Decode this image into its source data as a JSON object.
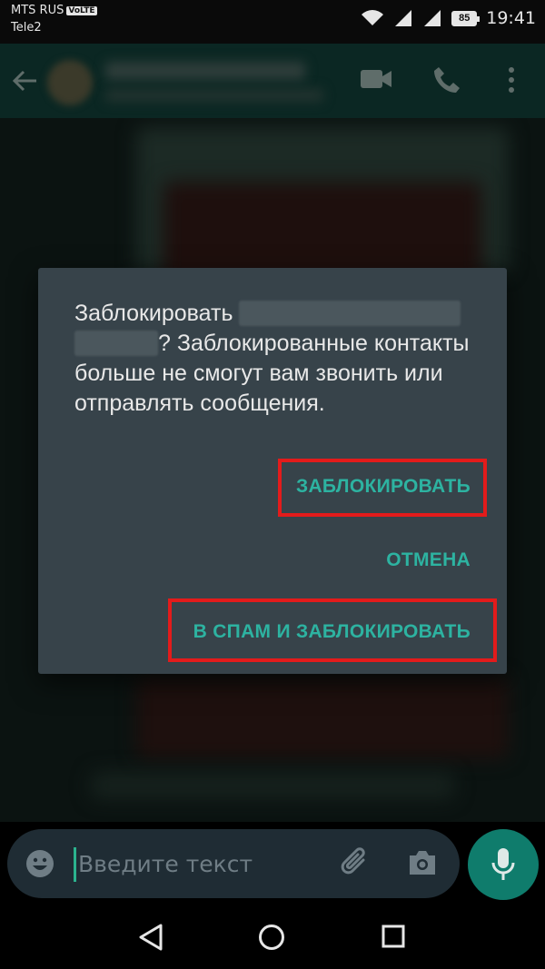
{
  "status_bar": {
    "carrier1": "MTS RUS",
    "volte": "VoLTE",
    "carrier2": "Tele2",
    "battery": "85",
    "time": "19:41"
  },
  "app_bar": {
    "icons": [
      "back-arrow-icon",
      "video-call-icon",
      "phone-call-icon",
      "more-options-icon"
    ]
  },
  "dialog": {
    "message_start": "Заблокировать",
    "message_rest": "? Заблокированные контакты больше не смогут вам звонить или отправлять сообщения.",
    "block_label": "ЗАБЛОКИРОВАТЬ",
    "cancel_label": "ОТМЕНА",
    "spam_block_label": "В СПАМ И ЗАБЛОКИРОВАТЬ"
  },
  "composer": {
    "placeholder": "Введите текст",
    "icons": [
      "emoji-icon",
      "attach-icon",
      "camera-icon",
      "mic-icon"
    ]
  },
  "colors": {
    "accent": "#2db3a1",
    "highlight": "#e31b1b",
    "dialog_bg": "#37434a",
    "fab": "#0f7c6c"
  }
}
